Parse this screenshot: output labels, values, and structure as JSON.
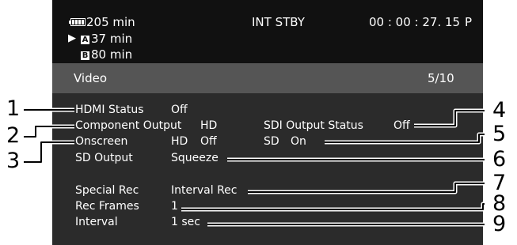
{
  "status_bar": {
    "battery_remaining": "205 min",
    "card_a_time": "37 min",
    "card_b_time": "80 min",
    "card_a_letter": "A",
    "card_b_letter": "B",
    "mode": "INT STBY",
    "timecode": "00 : 00 : 27. 15",
    "timecode_flag": "P"
  },
  "menu": {
    "title": "Video",
    "page": "5/10"
  },
  "settings": {
    "hdmi_status": {
      "label": "HDMI Status",
      "value": "Off"
    },
    "component_output": {
      "label": "Component Output",
      "value": "HD"
    },
    "sdi_output_status": {
      "label": "SDI Output Status",
      "value": "Off"
    },
    "onscreen": {
      "label": "Onscreen",
      "hd_label": "HD",
      "hd_value": "Off",
      "sd_label": "SD",
      "sd_value": "On"
    },
    "sd_output": {
      "label": "SD Output",
      "value": "Squeeze"
    },
    "special_rec": {
      "label": "Special Rec",
      "value": "Interval Rec"
    },
    "rec_frames": {
      "label": "Rec Frames",
      "value": "1"
    },
    "interval": {
      "label": "Interval",
      "value": "1 sec"
    }
  },
  "callouts": [
    "1",
    "2",
    "3",
    "4",
    "5",
    "6",
    "7",
    "8",
    "9"
  ],
  "colors": {
    "screen_bg": "#2b2b2b",
    "top_bar_bg": "#111111",
    "title_bar_bg": "#555555",
    "text": "#ffffff"
  }
}
